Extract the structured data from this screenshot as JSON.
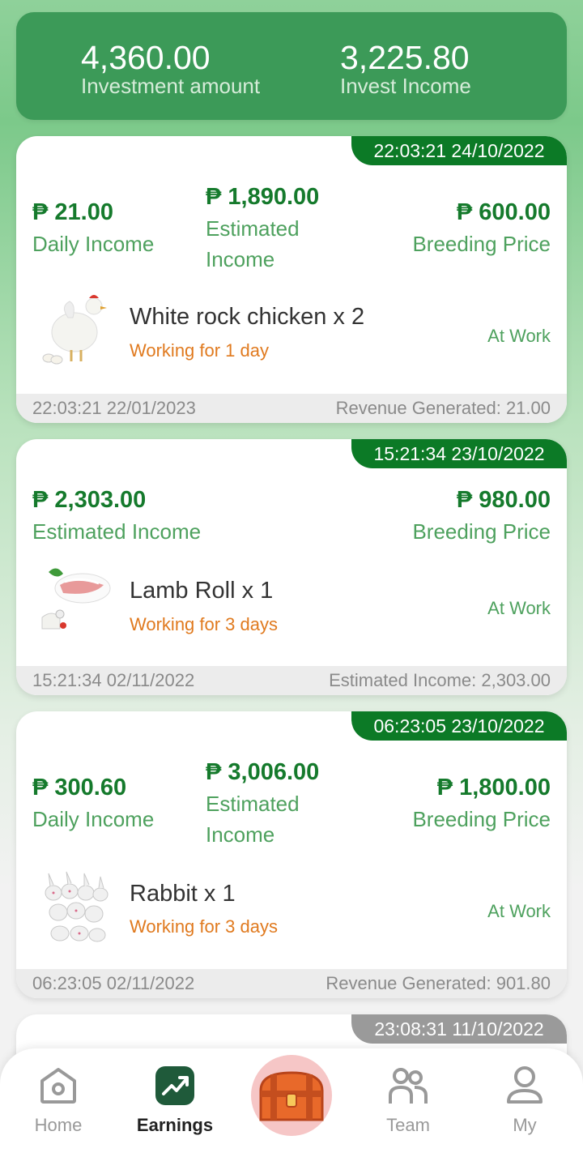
{
  "summary": {
    "investment_amount": "4,360.00",
    "investment_label": "Investment amount",
    "invest_income": "3,225.80",
    "invest_income_label": "Invest Income"
  },
  "orders": [
    {
      "stamp": "22:03:21 24/10/2022",
      "daily_income": "₱ 21.00",
      "daily_income_label": "Daily Income",
      "estimated_income": "₱ 1,890.00",
      "estimated_label_1": "Estimated",
      "estimated_label_2": "Income",
      "breeding_price": "₱ 600.00",
      "breeding_label": "Breeding Price",
      "product": "White rock chicken x 2",
      "working": "Working for 1 day",
      "status": "At Work",
      "footer_time": "22:03:21 22/01/2023",
      "footer_note": "Revenue Generated: 21.00",
      "thumb_icon": "chicken-icon"
    },
    {
      "stamp": "15:21:34 23/10/2022",
      "estimated_income": "₱ 2,303.00",
      "estimated_label": "Estimated Income",
      "breeding_price": "₱ 980.00",
      "breeding_label": "Breeding Price",
      "product": "Lamb Roll x 1",
      "working": "Working for 3 days",
      "status": "At Work",
      "footer_time": "15:21:34 02/11/2022",
      "footer_note": "Estimated Income: 2,303.00",
      "thumb_icon": "lamb-roll-icon"
    },
    {
      "stamp": "06:23:05 23/10/2022",
      "daily_income": "₱ 300.60",
      "daily_income_label": "Daily Income",
      "estimated_income": "₱ 3,006.00",
      "estimated_label_1": "Estimated",
      "estimated_label_2": "Income",
      "breeding_price": "₱ 1,800.00",
      "breeding_label": "Breeding Price",
      "product": "Rabbit x 1",
      "working": "Working for 3 days",
      "status": "At Work",
      "footer_time": "06:23:05 02/11/2022",
      "footer_note": "Revenue Generated: 901.80",
      "thumb_icon": "rabbit-icon"
    },
    {
      "stamp": "23:08:31 11/10/2022"
    }
  ],
  "nav": {
    "home": "Home",
    "earnings": "Earnings",
    "team": "Team",
    "my": "My",
    "active": "earnings"
  },
  "colors": {
    "brand_green": "#157a2c",
    "accent_orange": "#e07a1f",
    "summary_bg": "#3c9a58"
  }
}
